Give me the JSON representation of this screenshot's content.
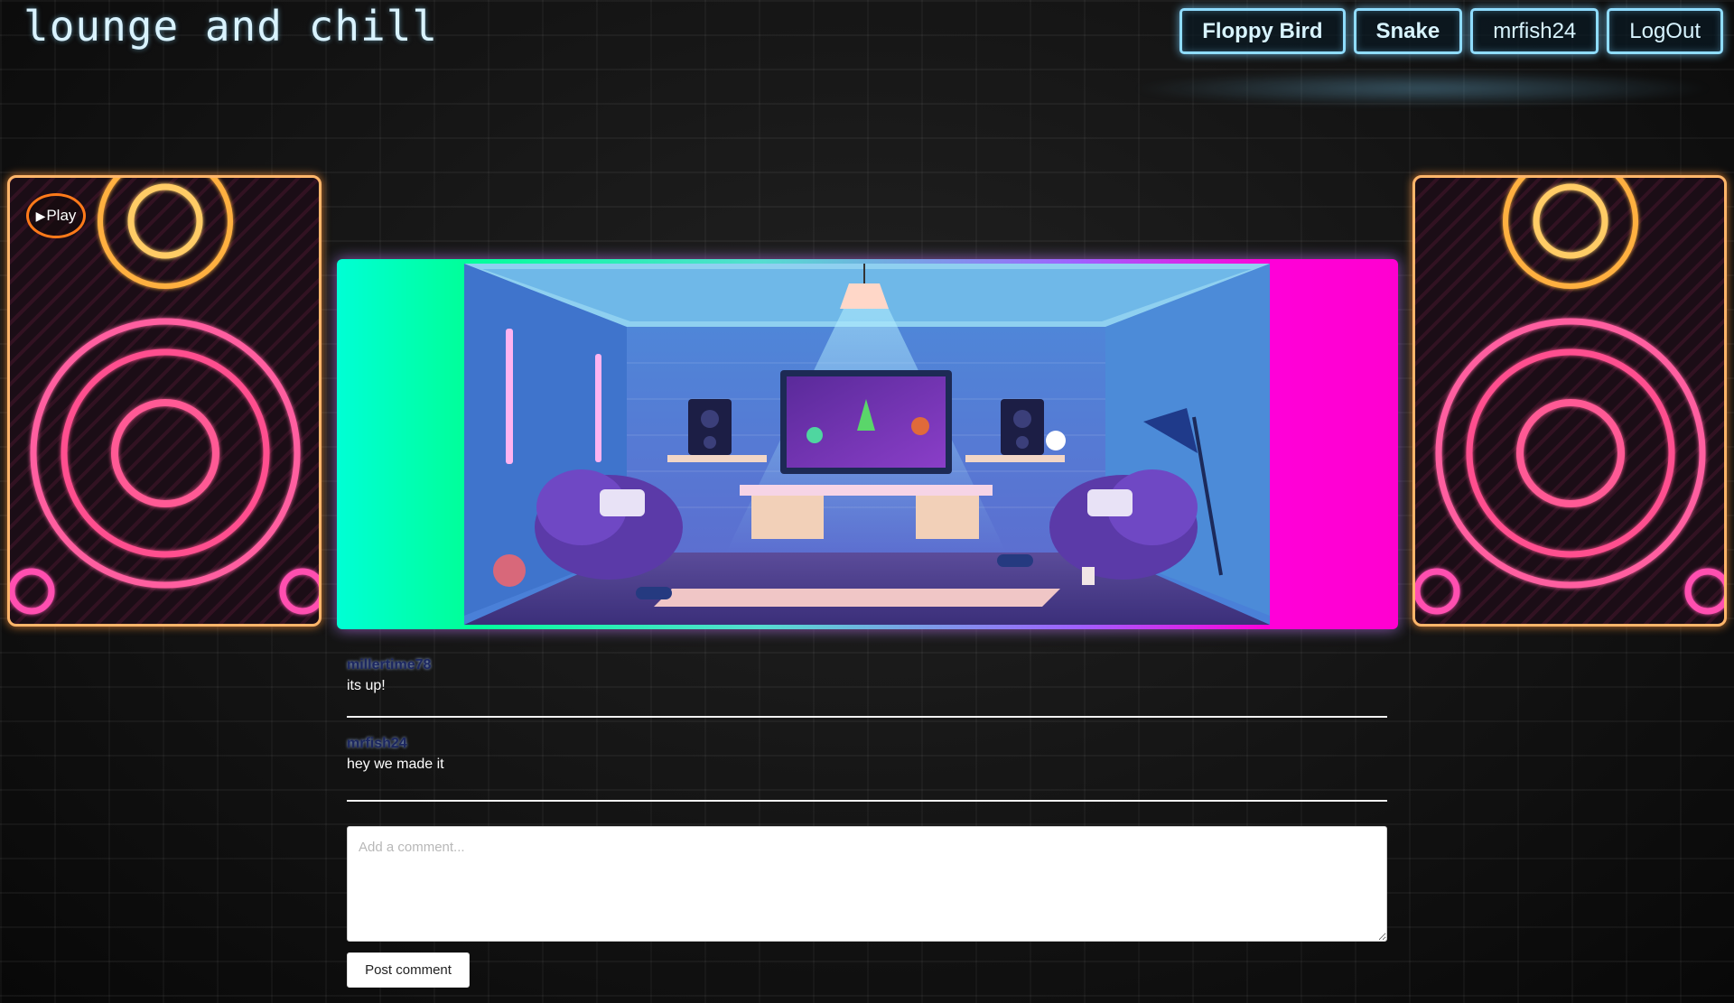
{
  "header": {
    "title": "lounge and chill",
    "nav": [
      {
        "label": "Floppy Bird"
      },
      {
        "label": "Snake"
      },
      {
        "label": "mrfish24"
      },
      {
        "label": "LogOut"
      }
    ]
  },
  "speakers": {
    "play_label": "Play",
    "play_icon": "play-triangle-icon",
    "colors": {
      "frame": "#ffb66a",
      "ring_outer": "#ff4fa8",
      "ring_top": "#ffc060"
    }
  },
  "banner": {
    "gradient_colors": [
      "#00ffd5",
      "#00ff9a",
      "#a060ff",
      "#ff00d8"
    ]
  },
  "comments": [
    {
      "user": "millertime78",
      "text": "its up!"
    },
    {
      "user": "mrfish24",
      "text": "hey we made it"
    }
  ],
  "comment_form": {
    "placeholder": "Add a comment...",
    "value": "",
    "submit_label": "Post comment"
  }
}
